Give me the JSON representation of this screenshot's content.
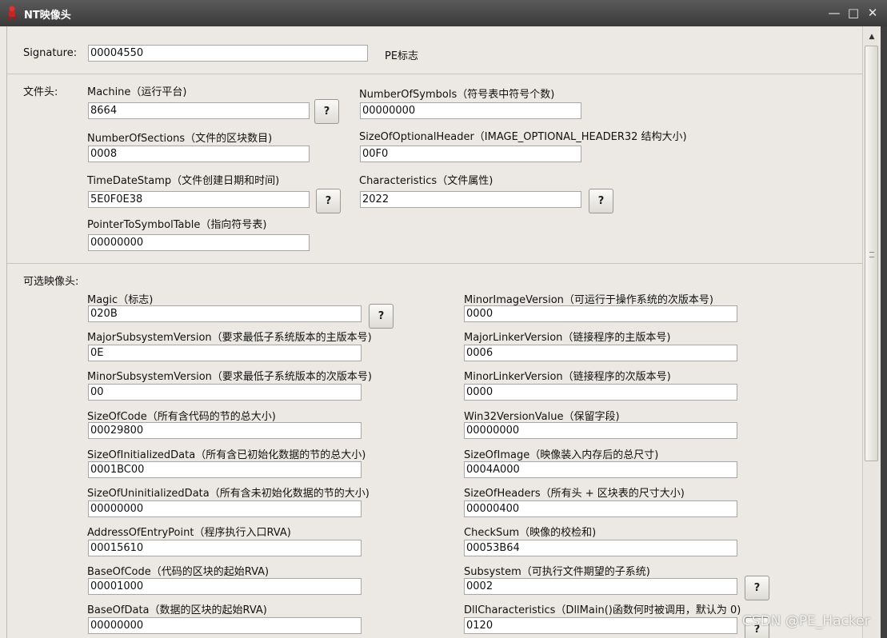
{
  "window": {
    "title": "NT映像头"
  },
  "signature": {
    "label": "Signature:",
    "value": "00004550",
    "note": "PE标志"
  },
  "file_header": {
    "section_label": "文件头:",
    "fields": [
      {
        "label": "Machine（运行平台)",
        "value": "8664"
      },
      {
        "label": "NumberOfSections（文件的区块数目)",
        "value": "0008"
      },
      {
        "label": "TimeDateStamp（文件创建日期和时间)",
        "value": "5E0F0E38"
      },
      {
        "label": "PointerToSymbolTable（指向符号表)",
        "value": "00000000"
      },
      {
        "label": "NumberOfSymbols（符号表中符号个数)",
        "value": "00000000"
      },
      {
        "label": "SizeOfOptionalHeader（IMAGE_OPTIONAL_HEADER32 结构大小)",
        "value": "00F0"
      },
      {
        "label": "Characteristics（文件属性)",
        "value": "2022"
      }
    ]
  },
  "optional_header": {
    "section_label": "可选映像头:",
    "fields": [
      {
        "label": "Magic（标志)",
        "value": "020B"
      },
      {
        "label": "MajorSubsystemVersion（要求最低子系统版本的主版本号)",
        "value": "0E"
      },
      {
        "label": "MinorSubsystemVersion（要求最低子系统版本的次版本号)",
        "value": "00"
      },
      {
        "label": "SizeOfCode（所有含代码的节的总大小)",
        "value": "00029800"
      },
      {
        "label": "SizeOfInitializedData（所有含已初始化数据的节的总大小)",
        "value": "0001BC00"
      },
      {
        "label": "SizeOfUninitializedData（所有含未初始化数据的节的大小)",
        "value": "00000000"
      },
      {
        "label": "AddressOfEntryPoint（程序执行入口RVA)",
        "value": "00015610"
      },
      {
        "label": "BaseOfCode（代码的区块的起始RVA)",
        "value": "00001000"
      },
      {
        "label": "BaseOfData（数据的区块的起始RVA)",
        "value": "00000000"
      },
      {
        "label": "MinorImageVersion（可运行于操作系统的次版本号)",
        "value": "0000"
      },
      {
        "label": "MajorLinkerVersion（链接程序的主版本号)",
        "value": "0006"
      },
      {
        "label": "MinorLinkerVersion（链接程序的次版本号)",
        "value": "0000"
      },
      {
        "label": "Win32VersionValue（保留字段)",
        "value": "00000000"
      },
      {
        "label": "SizeOfImage（映像装入内存后的总尺寸)",
        "value": "0004A000"
      },
      {
        "label": "SizeOfHeaders（所有头 + 区块表的尺寸大小)",
        "value": "00000400"
      },
      {
        "label": "CheckSum（映像的校检和)",
        "value": "00053B64"
      },
      {
        "label": "Subsystem（可执行文件期望的子系统)",
        "value": "0002"
      },
      {
        "label": "DllCharacteristics（DllMain()函数何时被调用，默认为 0)",
        "value": "0120"
      }
    ]
  },
  "help_button_label": "?",
  "watermark": "CSDN @PE_Hacker"
}
